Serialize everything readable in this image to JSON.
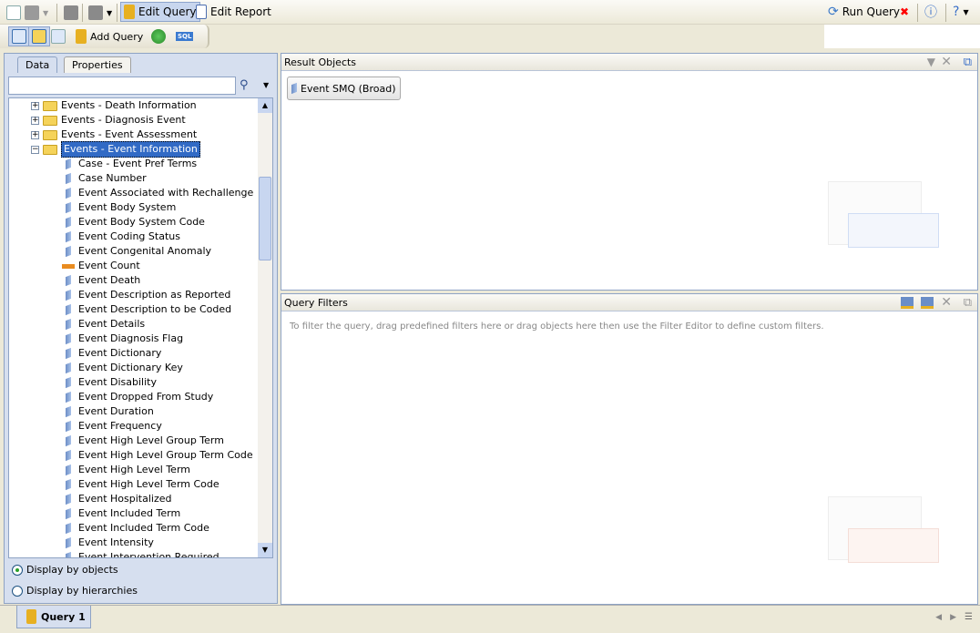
{
  "toolbar": {
    "edit_query": "Edit Query",
    "edit_report": "Edit Report",
    "run_query": "Run Query",
    "add_query": "Add Query",
    "sql": "SQL"
  },
  "left_panel": {
    "tabs": [
      "Data",
      "Properties"
    ],
    "active_tab": "Data",
    "search_value": "",
    "tree": [
      {
        "label": "Events - Death Information",
        "type": "folder",
        "expanded": false
      },
      {
        "label": "Events - Diagnosis Event",
        "type": "folder",
        "expanded": false
      },
      {
        "label": "Events - Event Assessment",
        "type": "folder",
        "expanded": false
      },
      {
        "label": "Events - Event Information",
        "type": "folder",
        "expanded": true,
        "selected": true
      },
      {
        "label": "Case - Event Pref Terms",
        "type": "dimension"
      },
      {
        "label": "Case Number",
        "type": "dimension"
      },
      {
        "label": "Event Associated with Rechallenge",
        "type": "dimension"
      },
      {
        "label": "Event Body System",
        "type": "dimension"
      },
      {
        "label": "Event Body System Code",
        "type": "dimension"
      },
      {
        "label": "Event Coding Status",
        "type": "dimension"
      },
      {
        "label": "Event Congenital Anomaly",
        "type": "dimension"
      },
      {
        "label": "Event Count",
        "type": "measure"
      },
      {
        "label": "Event Death",
        "type": "dimension"
      },
      {
        "label": "Event Description as Reported",
        "type": "dimension"
      },
      {
        "label": "Event Description to be Coded",
        "type": "dimension"
      },
      {
        "label": "Event Details",
        "type": "dimension"
      },
      {
        "label": "Event Diagnosis Flag",
        "type": "dimension"
      },
      {
        "label": "Event Dictionary",
        "type": "dimension"
      },
      {
        "label": "Event Dictionary Key",
        "type": "dimension"
      },
      {
        "label": "Event Disability",
        "type": "dimension"
      },
      {
        "label": "Event Dropped From Study",
        "type": "dimension"
      },
      {
        "label": "Event Duration",
        "type": "dimension"
      },
      {
        "label": "Event Frequency",
        "type": "dimension"
      },
      {
        "label": "Event High Level Group Term",
        "type": "dimension"
      },
      {
        "label": "Event High Level Group Term Code",
        "type": "dimension"
      },
      {
        "label": "Event High Level Term",
        "type": "dimension"
      },
      {
        "label": "Event High Level Term Code",
        "type": "dimension"
      },
      {
        "label": "Event Hospitalized",
        "type": "dimension"
      },
      {
        "label": "Event Included Term",
        "type": "dimension"
      },
      {
        "label": "Event Included Term Code",
        "type": "dimension"
      },
      {
        "label": "Event Intensity",
        "type": "dimension"
      },
      {
        "label": "Event Intervention Required",
        "type": "dimension"
      }
    ],
    "display_options": [
      {
        "label": "Display by objects",
        "checked": true
      },
      {
        "label": "Display by hierarchies",
        "checked": false
      }
    ]
  },
  "result_objects": {
    "title": "Result Objects",
    "items": [
      "Event SMQ (Broad)"
    ]
  },
  "query_filters": {
    "title": "Query Filters",
    "hint": "To filter the query, drag predefined filters here or drag objects here then use the Filter Editor to define custom filters."
  },
  "bottom_tabs": [
    "Query 1"
  ]
}
